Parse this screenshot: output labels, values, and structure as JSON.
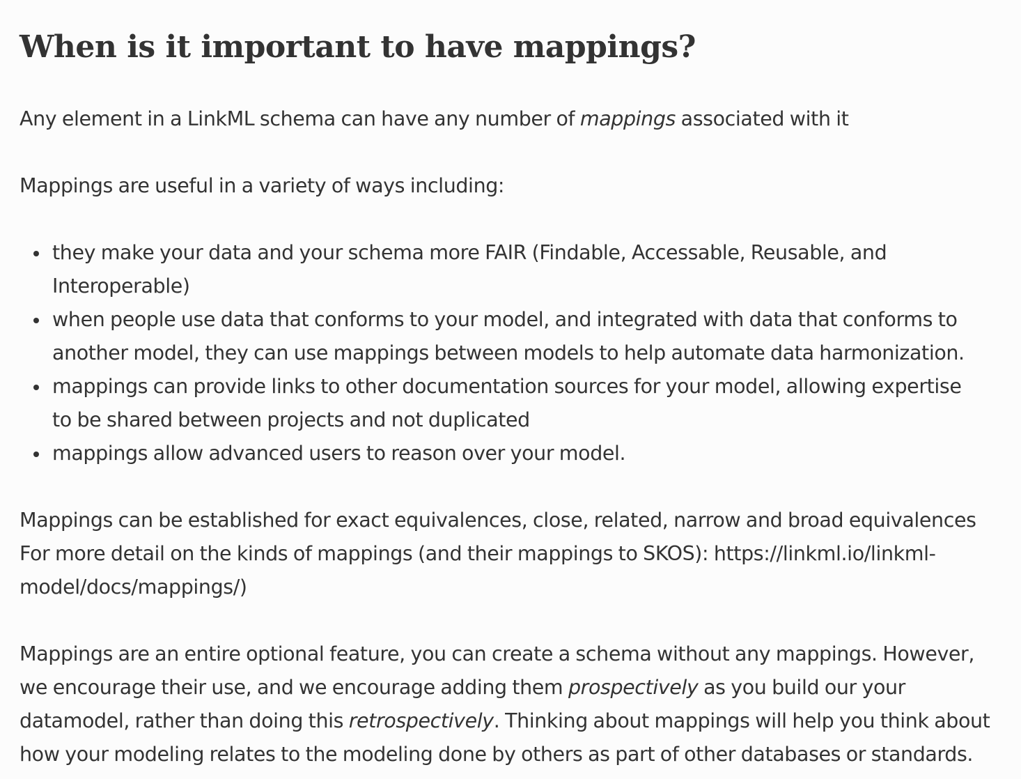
{
  "title": "When is it important to have mappings?",
  "intro": {
    "before": "Any element in a LinkML schema can have any number of ",
    "emphasis": "mappings",
    "after": " associated with it"
  },
  "useful_intro": "Mappings are useful in a variety of ways including:",
  "bullets": [
    {
      "line1": "they make your data and your schema more FAIR (Findable, Accessable, Reusable, and",
      "line2": "Interoperable)"
    },
    {
      "line1": "when people use data that conforms to your model, and integrated with data that conforms to",
      "line2": "another model, they can use mappings between models to help automate data harmonization."
    },
    {
      "line1": "mappings can provide links to other documentation sources for your model, allowing expertise",
      "line2": "to be shared between projects and not duplicated"
    },
    {
      "line1": "mappings allow advanced users to reason over your model."
    }
  ],
  "kinds": {
    "line1": "Mappings can be established for exact equivalences, close, related, narrow and broad equivalences",
    "line2": "For more detail on the kinds of mappings (and their mappings to SKOS): https://linkml.io/linkml-",
    "line3": "model/docs/mappings/)"
  },
  "optional": {
    "line1": "Mappings are an entire optional feature, you can create a schema without any mappings. However,",
    "line2_before": "we encourage their use, and we encourage adding them ",
    "line2_em": "prospectively",
    "line2_after": " as you build our your",
    "line3_before": "datamodel, rather than doing this ",
    "line3_em": "retrospectively",
    "line3_after": ". Thinking about mappings will help you think about",
    "line4": "how your modeling relates to the modeling done by others as part of other databases or standards."
  }
}
